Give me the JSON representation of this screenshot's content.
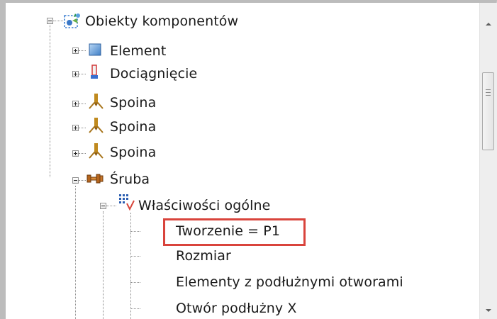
{
  "tree": {
    "root": {
      "label": "Obiekty komponentów",
      "icon": "component-objects-icon"
    },
    "children": [
      {
        "label": "Element",
        "icon": "element-icon"
      },
      {
        "label": "Dociągnięcie",
        "icon": "stiffener-icon"
      },
      {
        "label": "Spoina",
        "icon": "weld-icon"
      },
      {
        "label": "Spoina",
        "icon": "weld-icon"
      },
      {
        "label": "Spoina",
        "icon": "weld-icon"
      },
      {
        "label": "Śruba",
        "icon": "bolt-icon"
      }
    ],
    "bolt_children": [
      {
        "label": "Właściwości ogólne",
        "icon": "properties-icon"
      }
    ],
    "properties_items": [
      {
        "label": "Tworzenie = P1",
        "highlighted": true
      },
      {
        "label": "Rozmiar"
      },
      {
        "label": "Elementy z podłużnymi otworami"
      },
      {
        "label": "Otwór podłużny X"
      }
    ]
  },
  "colors": {
    "highlight_border": "#d9443c",
    "element_icon": "#4a86c5",
    "weld_icon": "#b8860b",
    "bolt_icon": "#9a5a1a"
  }
}
